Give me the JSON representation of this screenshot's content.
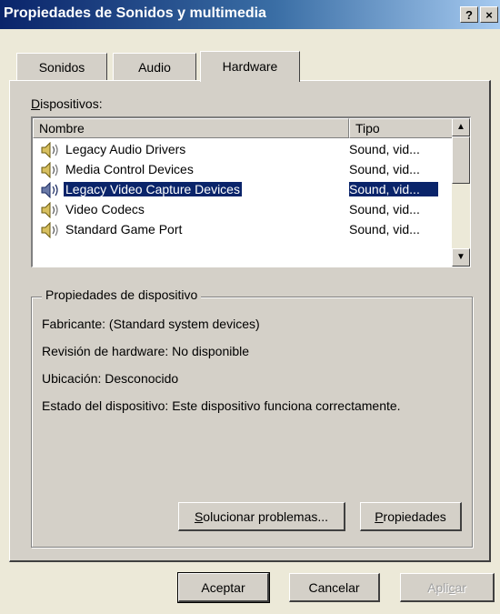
{
  "window": {
    "title": "Propiedades de Sonidos y multimedia",
    "help_label": "?",
    "close_label": "×"
  },
  "tabs": [
    {
      "label": "Sonidos",
      "active": false
    },
    {
      "label": "Audio",
      "active": false
    },
    {
      "label": "Hardware",
      "active": true
    }
  ],
  "devices": {
    "label_mnemonic": "D",
    "label_rest": "ispositivos:",
    "columns": {
      "name": "Nombre",
      "type": "Tipo"
    },
    "rows": [
      {
        "name": "Legacy Audio Drivers",
        "type": "Sound, vid...",
        "icon": "speaker-icon",
        "selected": false
      },
      {
        "name": "Media Control Devices",
        "type": "Sound, vid...",
        "icon": "speaker-icon",
        "selected": false
      },
      {
        "name": "Legacy Video Capture Devices",
        "type": "Sound, vid...",
        "icon": "speaker-icon",
        "selected": true
      },
      {
        "name": "Video Codecs",
        "type": "Sound, vid...",
        "icon": "speaker-icon",
        "selected": false
      },
      {
        "name": "Standard Game Port",
        "type": "Sound, vid...",
        "icon": "speaker-icon",
        "selected": false
      }
    ]
  },
  "properties": {
    "group_title": "Propiedades de dispositivo",
    "manufacturer": "Fabricante: (Standard system devices)",
    "hardware_revision": "Revisión de hardware: No disponible",
    "location": "Ubicación: Desconocido",
    "status": "Estado del dispositivo: Este dispositivo funciona correctamente.",
    "troubleshoot_mnemonic": "S",
    "troubleshoot_rest": "olucionar problemas...",
    "props_mnemonic": "P",
    "props_rest": "ropiedades"
  },
  "footer": {
    "ok_label": "Aceptar",
    "cancel_label": "Cancelar",
    "apply_pre": "Apli",
    "apply_mnemonic": "c",
    "apply_post": "ar"
  },
  "colors": {
    "selection": "#0a246a",
    "face": "#d4d0c8",
    "title_start": "#0a246a",
    "title_end": "#a6caf0"
  }
}
